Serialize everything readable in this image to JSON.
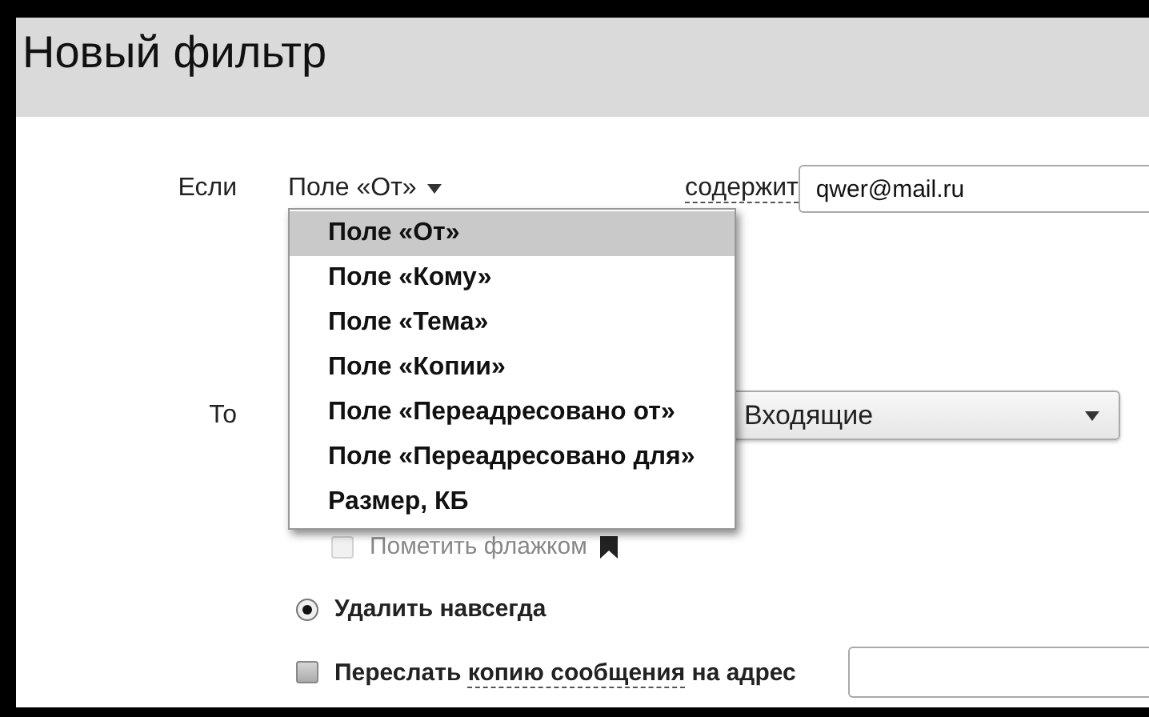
{
  "window": {
    "title": "Новый фильтр"
  },
  "condition": {
    "label": "Если",
    "field": "Поле «От»",
    "operator": "содержит",
    "value": "qwer@mail.ru"
  },
  "field_menu": {
    "items": [
      {
        "label": "Поле «От»",
        "selected": true
      },
      {
        "label": "Поле «Кому»",
        "selected": false
      },
      {
        "label": "Поле «Тема»",
        "selected": false
      },
      {
        "label": "Поле «Копии»",
        "selected": false
      },
      {
        "label": "Поле «Переадресовано от»",
        "selected": false
      },
      {
        "label": "Поле «Переадресовано для»",
        "selected": false
      },
      {
        "label": "Размер, КБ",
        "selected": false
      }
    ]
  },
  "action": {
    "label": "То",
    "folder": "Входящие"
  },
  "options": [
    {
      "kind": "checkbox",
      "label": "Пометить флажком",
      "checked": false,
      "disabled": true,
      "flag": true
    },
    {
      "kind": "radio",
      "label": "Удалить навсегда",
      "selected": true
    },
    {
      "kind": "checkbox",
      "label": "Переслать",
      "link": "копию сообщения",
      "label_after": "на адрес",
      "checked": false,
      "disabled": false,
      "address_field": true
    }
  ]
}
